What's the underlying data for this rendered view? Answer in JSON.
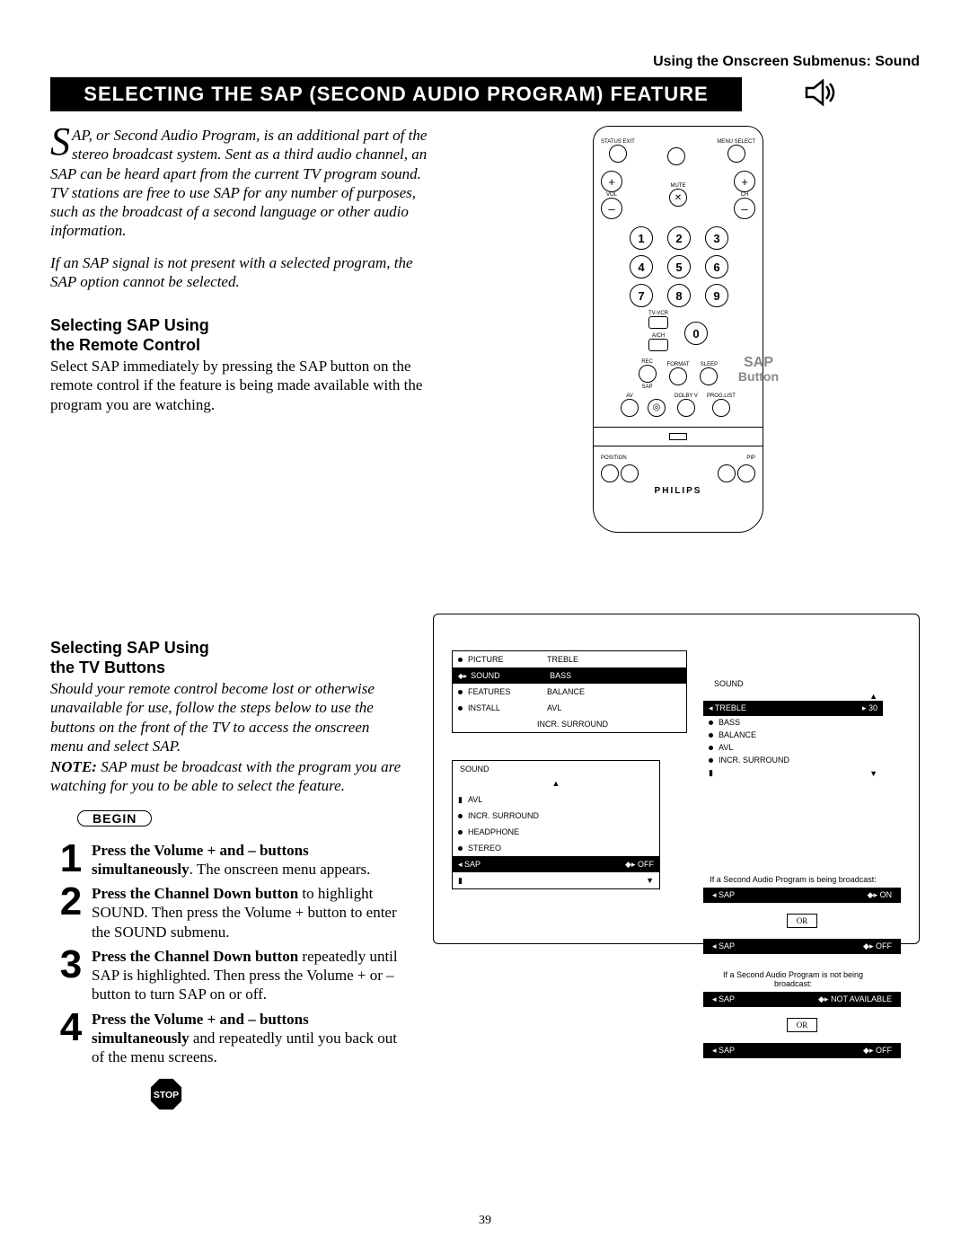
{
  "header_right": "Using the Onscreen Submenus: Sound",
  "title": "SELECTING THE SAP (SECOND AUDIO PROGRAM) FEATURE",
  "intro_dropcap": "S",
  "intro_text": "AP, or Second Audio Program, is an additional part of the stereo broadcast system. Sent as a third audio channel, an SAP can be heard apart from the current TV program sound. TV stations are free to use SAP for any number of purposes, such as the broadcast of a second language or other audio information.",
  "intro_note": "If an SAP signal is not present with a selected program, the SAP option cannot be selected.",
  "section1_title_l1": "Selecting SAP Using",
  "section1_title_l2": "the Remote Control",
  "section1_para": "Select SAP immediately by pressing the SAP button on the remote control if the feature is being made available with the program you are watching.",
  "section2_title_l1": "Selecting SAP Using",
  "section2_title_l2": "the TV Buttons",
  "section2_intro": "Should your remote control become lost or otherwise unavailable for use, follow the steps below to use the buttons on the front of the TV to access the onscreen menu and select SAP.",
  "section2_note_bold": "NOTE:",
  "section2_note_rest": " SAP must be broadcast with the program you are watching for you to be able to select the feature.",
  "begin_label": "BEGIN",
  "steps": [
    {
      "num": "1",
      "bold": "Press the Volume + and – buttons simultaneously",
      "rest": ". The onscreen menu appears."
    },
    {
      "num": "2",
      "bold": "Press the Channel Down button",
      "rest": " to highlight SOUND. Then press the Volume + button to enter the SOUND submenu."
    },
    {
      "num": "3",
      "bold": "Press the Channel Down button",
      "rest": " repeatedly until SAP is highlighted. Then press the Volume + or – button to turn SAP on or off."
    },
    {
      "num": "4",
      "bold": "Press the Volume + and – buttons simultaneously",
      "rest": " and repeatedly until you back out of the menu screens."
    }
  ],
  "stop_label": "STOP",
  "remote": {
    "top_left": "STATUS EXIT",
    "top_right": "MENU SELECT",
    "vol": "VOL",
    "ch": "CH",
    "mute": "MUTE",
    "numbers": [
      "1",
      "2",
      "3",
      "4",
      "5",
      "6",
      "7",
      "8",
      "9",
      "0"
    ],
    "tv_vcr": "TV-VCR",
    "ach": "A/CH",
    "format": "FORMAT",
    "sleep": "SLEEP",
    "rec": "REC",
    "sap": "SAP",
    "av": "AV",
    "dolby": "DOLBY V",
    "proglist": "PROG.LIST",
    "position": "POSITION",
    "pip": "PIP",
    "brand": "PHILIPS",
    "callout_l1": "SAP",
    "callout_l2": "Button"
  },
  "menu1": {
    "left": [
      "PICTURE",
      "SOUND",
      "FEATURES",
      "INSTALL"
    ],
    "right": [
      "TREBLE",
      "BASS",
      "BALANCE",
      "AVL",
      "INCR. SURROUND"
    ],
    "selected_idx": 1
  },
  "menu2": {
    "title": "SOUND",
    "items": [
      "AVL",
      "INCR. SURROUND",
      "HEADPHONE",
      "STEREO",
      "SAP"
    ],
    "sap_value": "OFF",
    "selected_idx": 4
  },
  "side": {
    "title": "SOUND",
    "treble": "TREBLE",
    "treble_val": "30",
    "items": [
      "BASS",
      "BALANCE",
      "AVL",
      "INCR. SURROUND"
    ]
  },
  "states": {
    "broadcast_note": "If a Second Audio Program is being broadcast:",
    "not_broadcast_note": "If a Second Audio Program is not being broadcast:",
    "on": "ON",
    "off": "OFF",
    "na": "NOT AVAILABLE",
    "sap": "SAP",
    "or": "OR"
  },
  "page_number": "39"
}
